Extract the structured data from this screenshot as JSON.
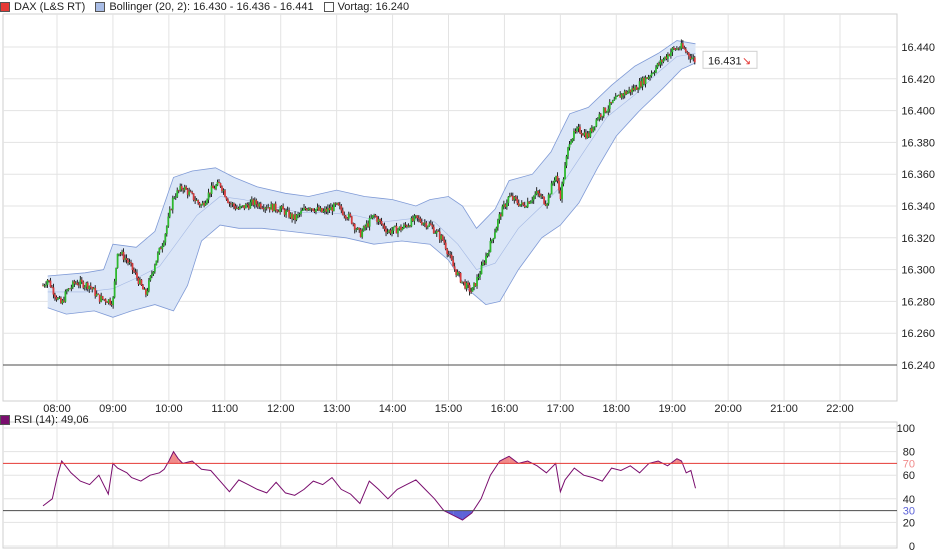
{
  "legend": {
    "dax": {
      "label": "DAX (L&S RT)",
      "color": "#e53935"
    },
    "bollinger": {
      "label": "Bollinger (20, 2): 16.430 - 16.436 - 16.441",
      "color": "#a9bde6"
    },
    "vortag": {
      "label": "Vortag: 16.240",
      "color": "#ffffff"
    }
  },
  "last_price": {
    "label": "16.431",
    "arrow": "↘"
  },
  "rsi_legend": {
    "label": "RSI (14): 49,06",
    "color": "#7a0e6e"
  },
  "colors": {
    "grid": "#e3e3e3",
    "bollinger_fill": "#dbe6f7",
    "bollinger_line": "#7f9ad6",
    "candle_up": "#2db82d",
    "candle_down": "#d63a3a",
    "candle_wick": "#111111",
    "rsi_line": "#7a0e6e",
    "rsi_upper": "#e53935",
    "rsi_upper_fill": "#f08a8a",
    "rsi_lower_fill": "#5d63d8",
    "rsi_lower": "#4b4b4b",
    "vortag_line": "#4b4b4b"
  },
  "chart_data": [
    {
      "type": "candlestick",
      "title": "DAX (L&S RT)",
      "x_ticks": [
        "08:00",
        "09:00",
        "10:00",
        "11:00",
        "12:00",
        "13:00",
        "14:00",
        "15:00",
        "16:00",
        "17:00",
        "18:00",
        "19:00",
        "20:00",
        "21:00",
        "22:00"
      ],
      "xlim": [
        "07:30",
        "22:50"
      ],
      "y_ticks": [
        "16.440",
        "16.420",
        "16.400",
        "16.380",
        "16.360",
        "16.340",
        "16.320",
        "16.300",
        "16.280",
        "16.260",
        "16.240"
      ],
      "ylim": [
        16232,
        16452
      ],
      "reference_line": {
        "name": "Vortag",
        "value": 16240
      },
      "last_value": 16431,
      "close_series": {
        "name": "DAX (L&S RT)",
        "points": [
          [
            "07:45",
            16290
          ],
          [
            "07:50",
            16294
          ],
          [
            "08:00",
            16282
          ],
          [
            "08:05",
            16278
          ],
          [
            "08:10",
            16286
          ],
          [
            "08:20",
            16292
          ],
          [
            "08:35",
            16290
          ],
          [
            "08:45",
            16282
          ],
          [
            "09:00",
            16280
          ],
          [
            "09:05",
            16312
          ],
          [
            "09:15",
            16306
          ],
          [
            "09:25",
            16296
          ],
          [
            "09:35",
            16284
          ],
          [
            "09:45",
            16304
          ],
          [
            "09:55",
            16320
          ],
          [
            "10:05",
            16346
          ],
          [
            "10:15",
            16352
          ],
          [
            "10:25",
            16346
          ],
          [
            "10:35",
            16340
          ],
          [
            "10:45",
            16350
          ],
          [
            "10:55",
            16354
          ],
          [
            "11:05",
            16342
          ],
          [
            "11:15",
            16338
          ],
          [
            "11:30",
            16342
          ],
          [
            "11:45",
            16340
          ],
          [
            "12:00",
            16338
          ],
          [
            "12:15",
            16332
          ],
          [
            "12:30",
            16340
          ],
          [
            "12:45",
            16336
          ],
          [
            "13:00",
            16340
          ],
          [
            "13:15",
            16332
          ],
          [
            "13:25",
            16322
          ],
          [
            "13:40",
            16334
          ],
          [
            "13:55",
            16324
          ],
          [
            "14:10",
            16326
          ],
          [
            "14:25",
            16332
          ],
          [
            "14:40",
            16328
          ],
          [
            "14:55",
            16318
          ],
          [
            "15:05",
            16302
          ],
          [
            "15:15",
            16292
          ],
          [
            "15:25",
            16286
          ],
          [
            "15:35",
            16300
          ],
          [
            "15:45",
            16316
          ],
          [
            "15:55",
            16334
          ],
          [
            "16:05",
            16346
          ],
          [
            "16:20",
            16340
          ],
          [
            "16:35",
            16348
          ],
          [
            "16:45",
            16342
          ],
          [
            "16:55",
            16360
          ],
          [
            "17:00",
            16346
          ],
          [
            "17:10",
            16382
          ],
          [
            "17:20",
            16388
          ],
          [
            "17:30",
            16384
          ],
          [
            "17:40",
            16396
          ],
          [
            "17:55",
            16404
          ],
          [
            "18:05",
            16410
          ],
          [
            "18:20",
            16414
          ],
          [
            "18:35",
            16422
          ],
          [
            "18:50",
            16432
          ],
          [
            "19:00",
            16438
          ],
          [
            "19:10",
            16440
          ],
          [
            "19:20",
            16434
          ],
          [
            "19:25",
            16431
          ]
        ]
      },
      "series": [
        {
          "name": "Bollinger (20, 2) upper",
          "points": [
            [
              "07:50",
              16296
            ],
            [
              "08:30",
              16298
            ],
            [
              "08:50",
              16300
            ],
            [
              "09:00",
              16316
            ],
            [
              "09:25",
              16314
            ],
            [
              "09:45",
              16324
            ],
            [
              "10:05",
              16358
            ],
            [
              "10:25",
              16362
            ],
            [
              "10:50",
              16364
            ],
            [
              "11:10",
              16358
            ],
            [
              "11:35",
              16352
            ],
            [
              "12:05",
              16348
            ],
            [
              "12:30",
              16346
            ],
            [
              "13:00",
              16350
            ],
            [
              "13:30",
              16346
            ],
            [
              "14:00",
              16344
            ],
            [
              "14:25",
              16340
            ],
            [
              "14:40",
              16344
            ],
            [
              "15:00",
              16346
            ],
            [
              "15:15",
              16340
            ],
            [
              "15:30",
              16326
            ],
            [
              "15:50",
              16338
            ],
            [
              "16:05",
              16356
            ],
            [
              "16:30",
              16360
            ],
            [
              "16:50",
              16374
            ],
            [
              "17:10",
              16398
            ],
            [
              "17:30",
              16402
            ],
            [
              "17:55",
              16416
            ],
            [
              "18:20",
              16428
            ],
            [
              "18:45",
              16436
            ],
            [
              "19:05",
              16444
            ],
            [
              "19:25",
              16442
            ]
          ]
        },
        {
          "name": "Bollinger (20, 2) middle",
          "points": [
            [
              "07:50",
              16286
            ],
            [
              "08:30",
              16286
            ],
            [
              "09:00",
              16288
            ],
            [
              "09:30",
              16296
            ],
            [
              "09:50",
              16302
            ],
            [
              "10:10",
              16318
            ],
            [
              "10:30",
              16334
            ],
            [
              "10:55",
              16346
            ],
            [
              "11:20",
              16344
            ],
            [
              "11:50",
              16340
            ],
            [
              "12:20",
              16336
            ],
            [
              "12:50",
              16336
            ],
            [
              "13:20",
              16334
            ],
            [
              "13:50",
              16330
            ],
            [
              "14:20",
              16332
            ],
            [
              "14:45",
              16330
            ],
            [
              "15:10",
              16316
            ],
            [
              "15:30",
              16300
            ],
            [
              "15:50",
              16304
            ],
            [
              "16:15",
              16326
            ],
            [
              "16:40",
              16340
            ],
            [
              "17:00",
              16352
            ],
            [
              "17:25",
              16374
            ],
            [
              "17:50",
              16396
            ],
            [
              "18:20",
              16410
            ],
            [
              "18:45",
              16424
            ],
            [
              "19:05",
              16434
            ],
            [
              "19:25",
              16436
            ]
          ]
        },
        {
          "name": "Bollinger (20, 2) lower",
          "points": [
            [
              "07:50",
              16276
            ],
            [
              "08:10",
              16272
            ],
            [
              "08:40",
              16274
            ],
            [
              "09:00",
              16270
            ],
            [
              "09:20",
              16274
            ],
            [
              "09:45",
              16278
            ],
            [
              "10:05",
              16274
            ],
            [
              "10:20",
              16290
            ],
            [
              "10:35",
              16318
            ],
            [
              "10:55",
              16328
            ],
            [
              "11:15",
              16326
            ],
            [
              "11:40",
              16326
            ],
            [
              "12:10",
              16324
            ],
            [
              "12:40",
              16322
            ],
            [
              "13:10",
              16320
            ],
            [
              "13:40",
              16316
            ],
            [
              "14:10",
              16318
            ],
            [
              "14:40",
              16316
            ],
            [
              "15:00",
              16306
            ],
            [
              "15:20",
              16288
            ],
            [
              "15:40",
              16278
            ],
            [
              "15:55",
              16280
            ],
            [
              "16:15",
              16300
            ],
            [
              "16:40",
              16320
            ],
            [
              "17:00",
              16328
            ],
            [
              "17:20",
              16342
            ],
            [
              "17:40",
              16364
            ],
            [
              "18:00",
              16384
            ],
            [
              "18:25",
              16400
            ],
            [
              "18:50",
              16414
            ],
            [
              "19:10",
              16426
            ],
            [
              "19:25",
              16430
            ]
          ]
        }
      ]
    },
    {
      "type": "line",
      "title": "RSI (14): 49,06",
      "x_ticks": [],
      "xlim": [
        "07:30",
        "22:50"
      ],
      "y_ticks": [
        "100",
        "80",
        "70",
        "60",
        "40",
        "30",
        "20",
        "0"
      ],
      "ylim": [
        0,
        100
      ],
      "thresholds": {
        "upper": 70,
        "lower": 30
      },
      "series": [
        {
          "name": "RSI (14)",
          "points": [
            [
              "07:45",
              34
            ],
            [
              "07:55",
              40
            ],
            [
              "08:00",
              58
            ],
            [
              "08:05",
              72
            ],
            [
              "08:15",
              62
            ],
            [
              "08:25",
              55
            ],
            [
              "08:35",
              52
            ],
            [
              "08:45",
              60
            ],
            [
              "08:55",
              44
            ],
            [
              "09:00",
              70
            ],
            [
              "09:05",
              66
            ],
            [
              "09:15",
              62
            ],
            [
              "09:20",
              58
            ],
            [
              "09:30",
              55
            ],
            [
              "09:40",
              60
            ],
            [
              "09:50",
              62
            ],
            [
              "09:55",
              65
            ],
            [
              "10:00",
              72
            ],
            [
              "10:05",
              80
            ],
            [
              "10:10",
              74
            ],
            [
              "10:15",
              70
            ],
            [
              "10:25",
              72
            ],
            [
              "10:35",
              65
            ],
            [
              "10:45",
              64
            ],
            [
              "10:55",
              55
            ],
            [
              "11:05",
              46
            ],
            [
              "11:15",
              56
            ],
            [
              "11:25",
              52
            ],
            [
              "11:35",
              48
            ],
            [
              "11:45",
              45
            ],
            [
              "11:55",
              54
            ],
            [
              "12:05",
              45
            ],
            [
              "12:15",
              43
            ],
            [
              "12:25",
              48
            ],
            [
              "12:35",
              55
            ],
            [
              "12:45",
              52
            ],
            [
              "12:55",
              58
            ],
            [
              "13:05",
              48
            ],
            [
              "13:15",
              44
            ],
            [
              "13:25",
              36
            ],
            [
              "13:35",
              55
            ],
            [
              "13:45",
              48
            ],
            [
              "13:55",
              40
            ],
            [
              "14:05",
              48
            ],
            [
              "14:15",
              52
            ],
            [
              "14:25",
              56
            ],
            [
              "14:35",
              48
            ],
            [
              "14:45",
              40
            ],
            [
              "14:55",
              30
            ],
            [
              "15:05",
              26
            ],
            [
              "15:15",
              22
            ],
            [
              "15:25",
              28
            ],
            [
              "15:35",
              40
            ],
            [
              "15:45",
              60
            ],
            [
              "15:55",
              72
            ],
            [
              "16:05",
              76
            ],
            [
              "16:15",
              70
            ],
            [
              "16:25",
              72
            ],
            [
              "16:35",
              68
            ],
            [
              "16:45",
              62
            ],
            [
              "16:55",
              70
            ],
            [
              "17:00",
              46
            ],
            [
              "17:05",
              56
            ],
            [
              "17:15",
              66
            ],
            [
              "17:25",
              60
            ],
            [
              "17:35",
              58
            ],
            [
              "17:45",
              55
            ],
            [
              "17:55",
              66
            ],
            [
              "18:05",
              64
            ],
            [
              "18:15",
              68
            ],
            [
              "18:25",
              62
            ],
            [
              "18:35",
              70
            ],
            [
              "18:45",
              72
            ],
            [
              "18:55",
              68
            ],
            [
              "19:05",
              74
            ],
            [
              "19:10",
              72
            ],
            [
              "19:15",
              62
            ],
            [
              "19:20",
              64
            ],
            [
              "19:25",
              49
            ]
          ]
        }
      ]
    }
  ]
}
